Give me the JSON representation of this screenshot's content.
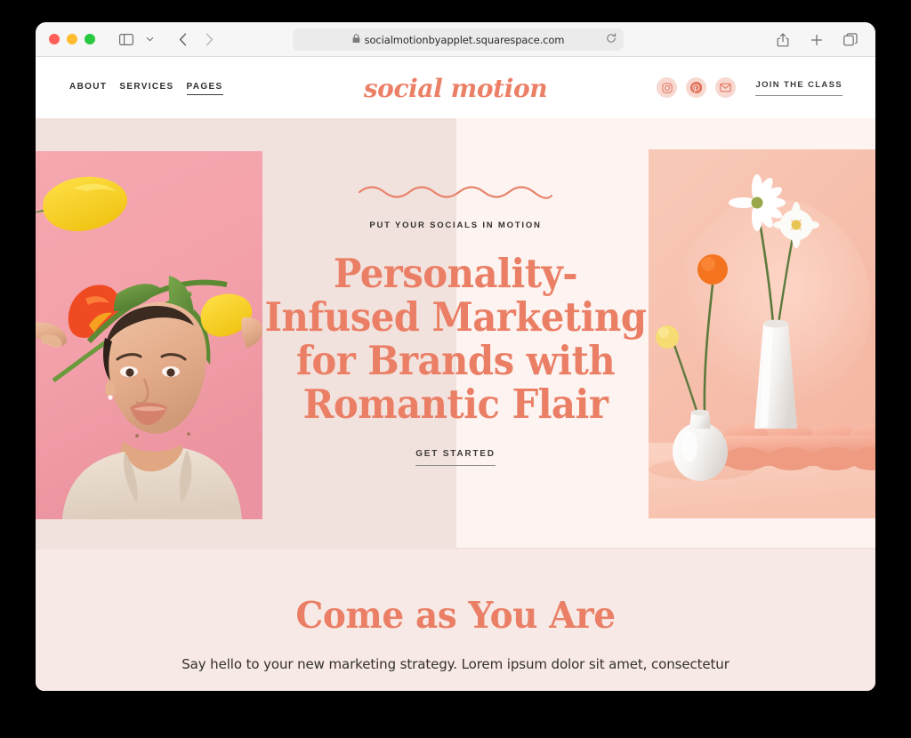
{
  "browser": {
    "address": "socialmotionbyapplet.squarespace.com",
    "icons": {
      "lock": "lock-icon",
      "reload": "reload-icon",
      "sidebar": "sidebar-toggle-icon",
      "chevron": "chevron-down-icon",
      "back": "back-arrow-icon",
      "forward": "forward-arrow-icon",
      "share": "share-icon",
      "new_tab": "plus-icon",
      "tabs": "tab-overview-icon"
    },
    "traffic_lights": {
      "close": "#ff5f57",
      "minimize": "#febc2e",
      "maximize": "#28c840"
    }
  },
  "site": {
    "logo": "social motion",
    "nav_links": [
      {
        "label": "ABOUT",
        "active": false
      },
      {
        "label": "SERVICES",
        "active": false
      },
      {
        "label": "PAGES",
        "active": true
      }
    ],
    "social_icons": [
      {
        "name": "instagram-icon"
      },
      {
        "name": "pinterest-icon"
      },
      {
        "name": "email-icon"
      }
    ],
    "cta_nav": "JOIN THE CLASS",
    "hero": {
      "eyebrow": "PUT YOUR SOCIALS IN MOTION",
      "headline_lines": [
        "Personality-",
        "Infused Marketing",
        "for Brands with",
        "Romantic Flair"
      ],
      "button": "GET STARTED",
      "left_image_alt": "woman-holding-tulips-photo",
      "right_image_alt": "white-vases-with-daisies-photo"
    },
    "section": {
      "heading": "Come as You Are",
      "subtext": "Say hello to your new marketing strategy. Lorem ipsum dolor sit amet, consectetur"
    },
    "colors": {
      "accent": "#ea7f66",
      "page_bg": "#f7e9e5",
      "hero_left_bg": "#f2e2dd",
      "hero_right_bg": "#fdf4f1",
      "social_circle_bg": "#f7d9d1"
    }
  }
}
